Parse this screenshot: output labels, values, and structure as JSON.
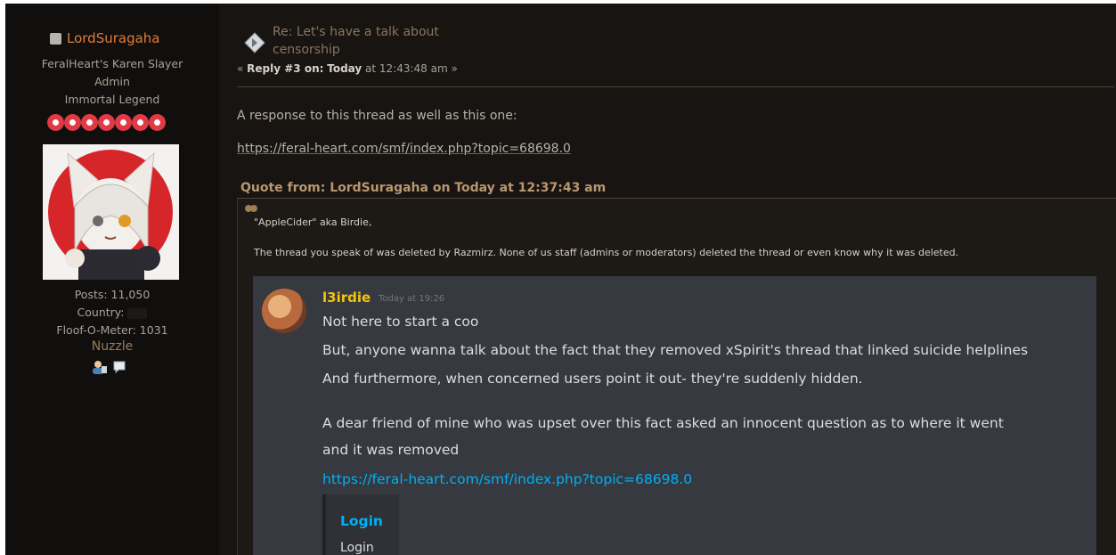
{
  "poster": {
    "username": "LordSuragaha",
    "custom_title": "FeralHeart's Karen Slayer",
    "group": "Admin",
    "post_group": "Immortal Legend",
    "star_count": 7,
    "posts_label": "Posts: 11,050",
    "country_label": "Country:",
    "floof_label": "Floof-O-Meter: 1031",
    "nuzzle_label": "Nuzzle",
    "colors": {
      "username": "#e07c39",
      "star": "#e03a45"
    }
  },
  "post": {
    "title": "Re: Let's have a talk about censorship",
    "meta_prefix": "« ",
    "meta_reply": "Reply #3 on:",
    "meta_today": "Today",
    "meta_time": "at 12:43:48 am »",
    "text_1": "A response to this thread as well as this one:",
    "link": "https://feral-heart.com/smf/index.php?topic=68698.0"
  },
  "quote": {
    "header": "Quote from: LordSuragaha on Today at 12:37:43 am",
    "greeting": "\"AppleCider\" aka Birdie,",
    "body": "The thread you speak of was deleted by Razmirz. None of us staff (admins or moderators) deleted the thread or even know why it was deleted."
  },
  "discord": {
    "username": "l3irdie",
    "timestamp": "Today at 19:26",
    "line_1": "Not here to start a coo",
    "line_2": "But, anyone wanna talk about the fact that they removed xSpirit's thread that linked suicide helplines",
    "line_3": "And furthermore, when concerned users point it out- they're suddenly hidden.",
    "line_4": "A dear friend of mine who was upset over this fact asked an innocent question as to where it went",
    "line_5": "and it was removed",
    "link": "https://feral-heart.com/smf/index.php?topic=68698.0",
    "embed_title": "Login",
    "embed_desc": "Login",
    "colors": {
      "background": "#36393f",
      "username": "#f1c40f",
      "link": "#00b0f4"
    }
  }
}
